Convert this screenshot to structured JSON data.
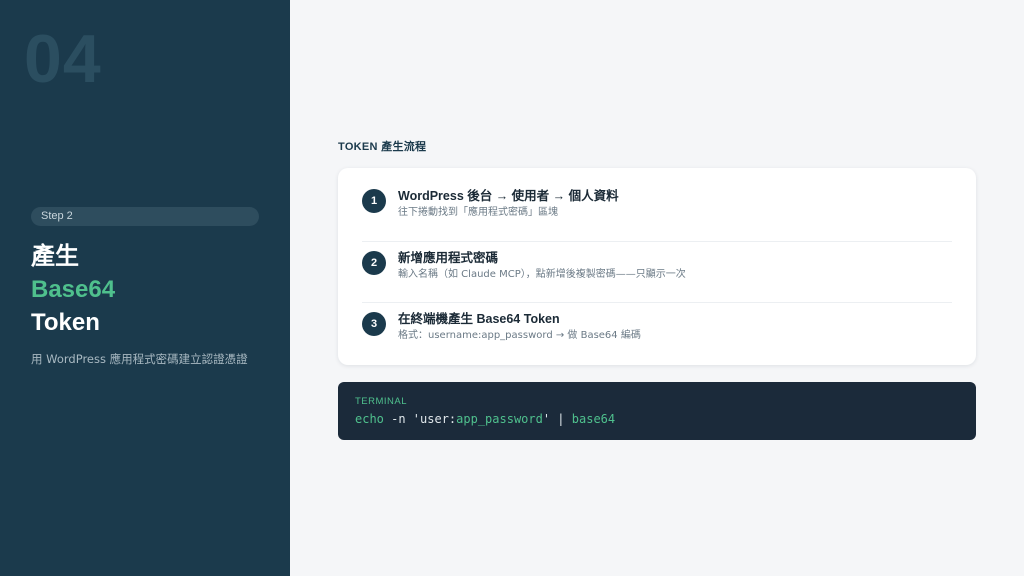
{
  "slide_number": "04",
  "step_pill": "Step 2",
  "title": {
    "line1": "產生",
    "line2": "Base64",
    "line3": "Token"
  },
  "subtitle": "用 WordPress 應用程式密碼建立認證憑證",
  "section_label": "TOKEN 產生流程",
  "steps": [
    {
      "num": "1",
      "title": "WordPress 後台 → 使用者 → 個人資料",
      "desc": "往下捲動找到「應用程式密碼」區塊"
    },
    {
      "num": "2",
      "title": "新增應用程式密碼",
      "desc": "輸入名稱（如 Claude MCP），點新增後複製密碼——只顯示一次"
    },
    {
      "num": "3",
      "title": "在終端機產生 Base64 Token",
      "desc": "格式：username:app_password → 做 Base64 編碼"
    }
  ],
  "terminal": {
    "label": "TERMINAL",
    "cmd_echo": "echo",
    "cmd_flag": " -n 'user:",
    "cmd_pass": "app_password",
    "cmd_pipe": "' | ",
    "cmd_base64": "base64"
  },
  "colors": {
    "sidebar": "#1b3a4c",
    "accent": "#4fc08d",
    "terminal_bg": "#1b2a3a"
  }
}
